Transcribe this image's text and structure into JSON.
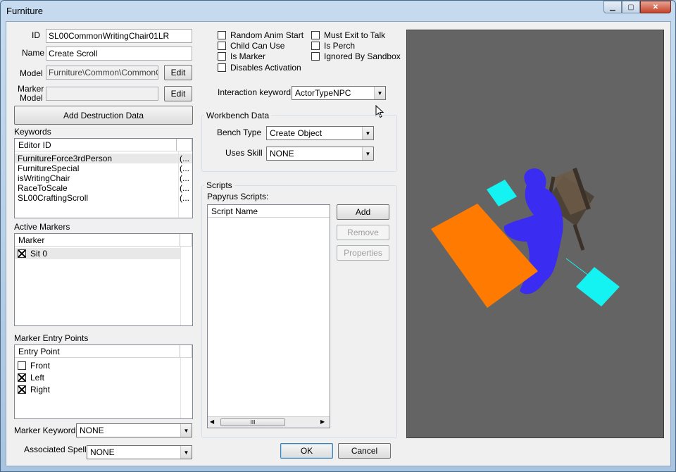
{
  "window": {
    "title": "Furniture",
    "minimize_icon": "minimize-icon",
    "maximize_icon": "maximize-icon",
    "close_icon": "close-icon"
  },
  "fields": {
    "id_label": "ID",
    "id_value": "SL00CommonWritingChair01LR",
    "name_label": "Name",
    "name_value": "Create Scroll",
    "model_label": "Model",
    "model_value": "Furniture\\Common\\CommonChai",
    "marker_model_label_1": "Marker",
    "marker_model_label_2": "Model",
    "marker_model_value": "",
    "edit_label": "Edit",
    "add_destruction_label": "Add Destruction Data"
  },
  "keywords": {
    "title": "Keywords",
    "columns": [
      "Editor ID",
      ""
    ],
    "rows": [
      {
        "id": "FurnitureForce3rdPerson",
        "extra": "(..."
      },
      {
        "id": "FurnitureSpecial",
        "extra": "(..."
      },
      {
        "id": "isWritingChair",
        "extra": "(..."
      },
      {
        "id": "RaceToScale",
        "extra": "(..."
      },
      {
        "id": "SL00CraftingScroll",
        "extra": "(..."
      }
    ]
  },
  "active_markers": {
    "title": "Active Markers",
    "column": "Marker",
    "rows": [
      {
        "label": "Sit 0",
        "checked": true
      }
    ]
  },
  "entry_points": {
    "title": "Marker Entry Points",
    "column": "Entry Point",
    "rows": [
      {
        "label": "Front",
        "checked": false
      },
      {
        "label": "Left",
        "checked": true
      },
      {
        "label": "Right",
        "checked": true
      }
    ]
  },
  "marker_keyword": {
    "label": "Marker Keyword",
    "value": "NONE"
  },
  "associated_spell": {
    "label": "Associated Spell",
    "value": "NONE"
  },
  "flags": [
    {
      "label": "Random Anim Start",
      "checked": false
    },
    {
      "label": "Child Can Use",
      "checked": false
    },
    {
      "label": "Is Marker",
      "checked": false
    },
    {
      "label": "Disables Activation",
      "checked": false
    },
    {
      "label": "Must Exit to Talk",
      "checked": false
    },
    {
      "label": "Is Perch",
      "checked": false
    },
    {
      "label": "Ignored By Sandbox",
      "checked": false
    }
  ],
  "interaction_keyword": {
    "label": "Interaction keyword",
    "value": "ActorTypeNPC"
  },
  "workbench": {
    "title": "Workbench Data",
    "bench_type_label": "Bench Type",
    "bench_type_value": "Create Object",
    "uses_skill_label": "Uses Skill",
    "uses_skill_value": "NONE"
  },
  "scripts": {
    "title": "Scripts",
    "subtitle": "Papyrus Scripts:",
    "column": "Script Name",
    "add_label": "Add",
    "remove_label": "Remove",
    "properties_label": "Properties",
    "scroll_thumb": "III"
  },
  "dialog": {
    "ok_label": "OK",
    "cancel_label": "Cancel"
  },
  "colors": {
    "viewport_bg": "#646464",
    "table": "#ff7a00",
    "figure": "#3a2cf0",
    "marker": "#14f2f2",
    "chair": "#5a4a3a"
  }
}
